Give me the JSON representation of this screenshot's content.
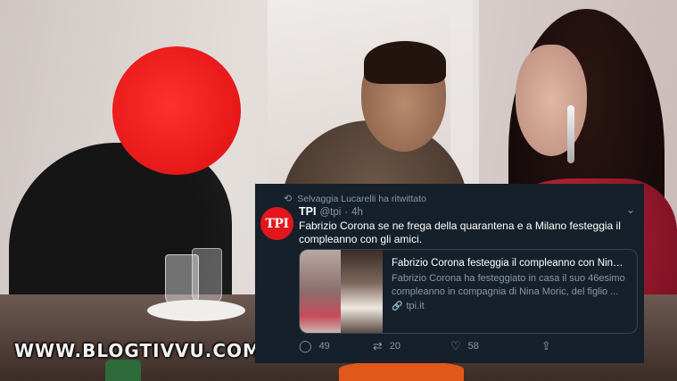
{
  "tweet": {
    "retweet_notice": "Selvaggia Lucarelli ha ritwittato",
    "avatar_text": "TPI",
    "name": "TPI",
    "handle": "@tpi",
    "separator": "·",
    "time": "4h",
    "text": "Fabrizio Corona se ne frega della quarantena e a Milano festeggia il compleanno con gli amici.",
    "card": {
      "title": "Fabrizio Corona festeggia il compleanno con Nina M...",
      "description": "Fabrizio Corona ha festeggiato in casa il suo 46esimo compleanno in compagnia di Nina Moric, del figlio ...",
      "link": "tpi.it"
    },
    "actions": {
      "replies": "49",
      "retweets": "20",
      "likes": "58"
    }
  },
  "watermark": "WWW.BLOGTIVVU.COM",
  "icons": {
    "retweet": "retweet-icon",
    "chevron": "chevron-down-icon",
    "reply": "reply-icon",
    "like": "heart-icon",
    "share": "share-icon",
    "link": "link-icon"
  },
  "colors": {
    "tweet_bg": "#15202b",
    "secondary_text": "#8899a6",
    "brand_red": "#e2161c",
    "censor_red": "#e71818"
  }
}
